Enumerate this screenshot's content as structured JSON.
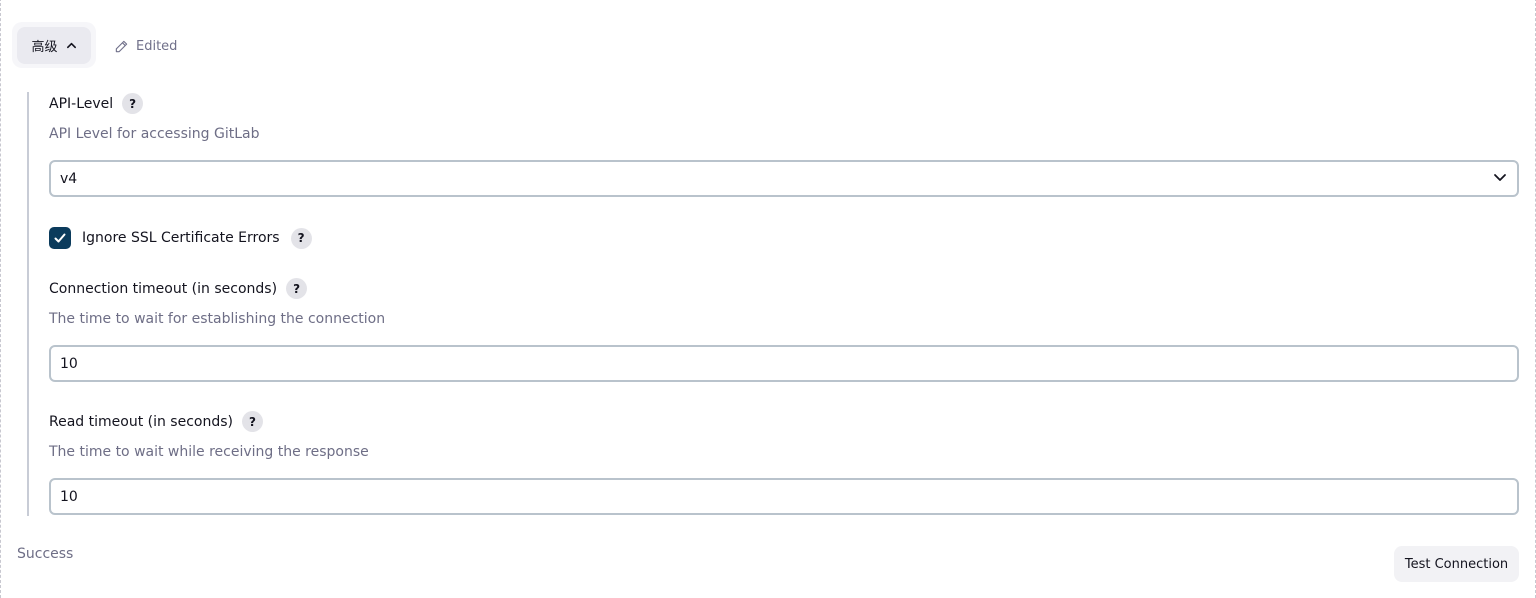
{
  "advanced": {
    "label": "高级",
    "edited_label": "Edited"
  },
  "api_level": {
    "label": "API-Level",
    "description": "API Level for accessing GitLab",
    "selected": "v4",
    "help": "?"
  },
  "ignore_ssl": {
    "label": "Ignore SSL Certificate Errors",
    "checked": true,
    "help": "?"
  },
  "connection_timeout": {
    "label": "Connection timeout (in seconds)",
    "description": "The time to wait for establishing the connection",
    "value": "10",
    "help": "?"
  },
  "read_timeout": {
    "label": "Read timeout (in seconds)",
    "description": "The time to wait while receiving the response",
    "value": "10",
    "help": "?"
  },
  "footer": {
    "status": "Success",
    "test_button": "Test Connection"
  },
  "colors": {
    "accent": "#0b3b5c",
    "border": "#b9c3cc",
    "muted_text": "#6e6e86"
  }
}
